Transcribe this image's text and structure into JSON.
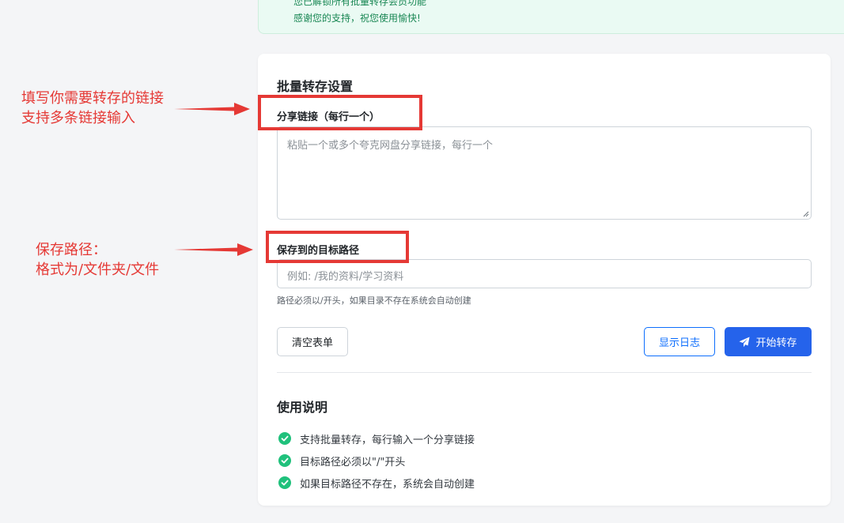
{
  "banner": {
    "line1": "您已解锁所有批量转存会员功能",
    "line2": "感谢您的支持，祝您使用愉快!"
  },
  "card": {
    "title": "批量转存设置",
    "links_label": "分享链接（每行一个）",
    "links_placeholder": "粘贴一个或多个夸克网盘分享链接，每行一个",
    "path_label": "保存到的目标路径",
    "path_placeholder": "例如: /我的资料/学习资料",
    "path_hint": "路径必须以/开头，如果目录不存在系统会自动创建",
    "buttons": {
      "clear": "清空表单",
      "show_log": "显示日志",
      "start": "开始转存"
    }
  },
  "usage": {
    "title": "使用说明",
    "items": [
      "支持批量转存，每行输入一个分享链接",
      "目标路径必须以\"/\"开头",
      "如果目标路径不存在，系统会自动创建"
    ]
  },
  "annotations": {
    "links_note_line1": "填写你需要转存的链接",
    "links_note_line2": "支持多条链接输入",
    "path_note_line1": "保存路径：",
    "path_note_line2": "格式为/文件夹/文件"
  },
  "colors": {
    "primary": "#2563eb",
    "outline_blue": "#0d6efd",
    "success_green": "#20c17c",
    "annotation_red": "#e53935"
  },
  "icons": {
    "start_button": "paper-plane-icon",
    "usage_item": "check-circle-icon"
  }
}
